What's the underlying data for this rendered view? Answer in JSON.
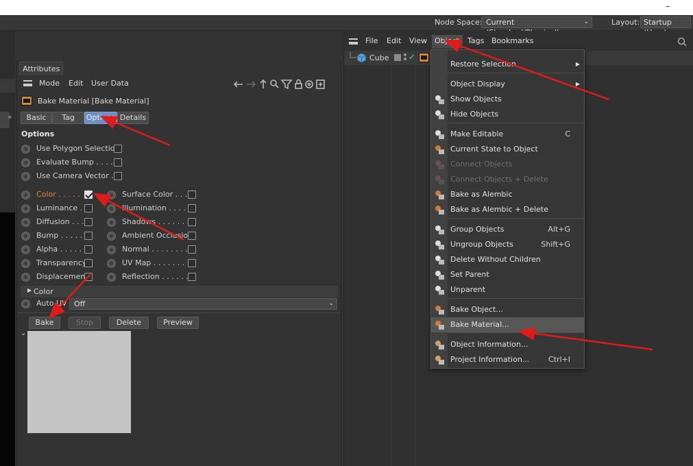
{
  "window": {
    "minimize_glyph": "–"
  },
  "topbar": {
    "node_space_label": "Node Space:",
    "node_space_value": "Current (Standard/Physical)",
    "layout_label": "Layout:",
    "layout_value": "Startup (User)"
  },
  "attributes": {
    "tab_title": "Attributes",
    "menu": [
      "Mode",
      "Edit",
      "User Data"
    ],
    "object_title": "Bake Material [Bake Material]",
    "tabs": [
      "Basic",
      "Tag",
      "Options",
      "Details"
    ],
    "selected_tab": "Options",
    "section_title": "Options",
    "top_options": [
      {
        "label": "Use Polygon Selection",
        "checked": false
      },
      {
        "label": "Evaluate Bump . . . . .",
        "checked": false
      },
      {
        "label": "Use Camera Vector . .",
        "checked": false
      }
    ],
    "left_channels": [
      {
        "label": "Color . . . . .",
        "checked": true
      },
      {
        "label": "Luminance . .",
        "checked": false
      },
      {
        "label": "Diffusion . . .",
        "checked": false
      },
      {
        "label": "Bump . . . . .",
        "checked": false
      },
      {
        "label": "Alpha . . . . .",
        "checked": false
      },
      {
        "label": "Transparency",
        "checked": false
      },
      {
        "label": "Displacement",
        "checked": false
      }
    ],
    "right_channels": [
      {
        "label": "Surface Color . . . .",
        "checked": false
      },
      {
        "label": "Illumination . . . . .",
        "checked": false
      },
      {
        "label": "Shadows . . . . . . .",
        "checked": false
      },
      {
        "label": "Ambient Occlusion",
        "checked": false
      },
      {
        "label": "Normal . . . . . . . .",
        "checked": false
      },
      {
        "label": "UV Map . . . . . . .",
        "checked": false
      },
      {
        "label": "Reflection . . . . . .",
        "checked": false
      }
    ],
    "color_group_label": "Color",
    "auto_uv_label": "Auto UV",
    "auto_uv_value": "Off",
    "buttons": {
      "bake": "Bake",
      "stop": "Stop",
      "delete": "Delete",
      "preview": "Preview"
    },
    "expand_glyph": "»"
  },
  "object_manager": {
    "menu": [
      "File",
      "Edit",
      "View",
      "Object",
      "Tags",
      "Bookmarks"
    ],
    "object_name": "Cube"
  },
  "object_menu": {
    "items": [
      {
        "label": "Restore Selection",
        "shortcut": "",
        "submenu": true,
        "disabled": false
      },
      {
        "label": "Object Display",
        "shortcut": "",
        "submenu": true,
        "disabled": false
      },
      {
        "label": "Show Objects",
        "shortcut": "",
        "submenu": false,
        "disabled": false
      },
      {
        "label": "Hide Objects",
        "shortcut": "",
        "submenu": false,
        "disabled": false
      },
      {
        "label": "Make Editable",
        "shortcut": "C",
        "submenu": false,
        "disabled": false
      },
      {
        "label": "Current State to Object",
        "shortcut": "",
        "submenu": false,
        "disabled": false
      },
      {
        "label": "Connect Objects",
        "shortcut": "",
        "submenu": false,
        "disabled": true
      },
      {
        "label": "Connect Objects + Delete",
        "shortcut": "",
        "submenu": false,
        "disabled": true
      },
      {
        "label": "Bake as Alembic",
        "shortcut": "",
        "submenu": false,
        "disabled": false
      },
      {
        "label": "Bake as Alembic + Delete",
        "shortcut": "",
        "submenu": false,
        "disabled": false
      },
      {
        "label": "Group Objects",
        "shortcut": "Alt+G",
        "submenu": false,
        "disabled": false
      },
      {
        "label": "Ungroup Objects",
        "shortcut": "Shift+G",
        "submenu": false,
        "disabled": false
      },
      {
        "label": "Delete Without Children",
        "shortcut": "",
        "submenu": false,
        "disabled": false
      },
      {
        "label": "Set Parent",
        "shortcut": "",
        "submenu": false,
        "disabled": false
      },
      {
        "label": "Unparent",
        "shortcut": "",
        "submenu": false,
        "disabled": false
      },
      {
        "label": "Bake Object...",
        "shortcut": "",
        "submenu": false,
        "disabled": false
      },
      {
        "label": "Bake Material...",
        "shortcut": "",
        "submenu": false,
        "disabled": false,
        "highlighted": true
      },
      {
        "label": "Object Information...",
        "shortcut": "",
        "submenu": false,
        "disabled": false
      },
      {
        "label": "Project Information...",
        "shortcut": "Ctrl+I",
        "submenu": false,
        "disabled": false
      }
    ]
  },
  "colors": {
    "accent_selected_tab": "#6b8fc7",
    "color_label": "#e08a3a",
    "cube_label": "#e0a040",
    "annotation_arrow": "#e01b1b"
  }
}
